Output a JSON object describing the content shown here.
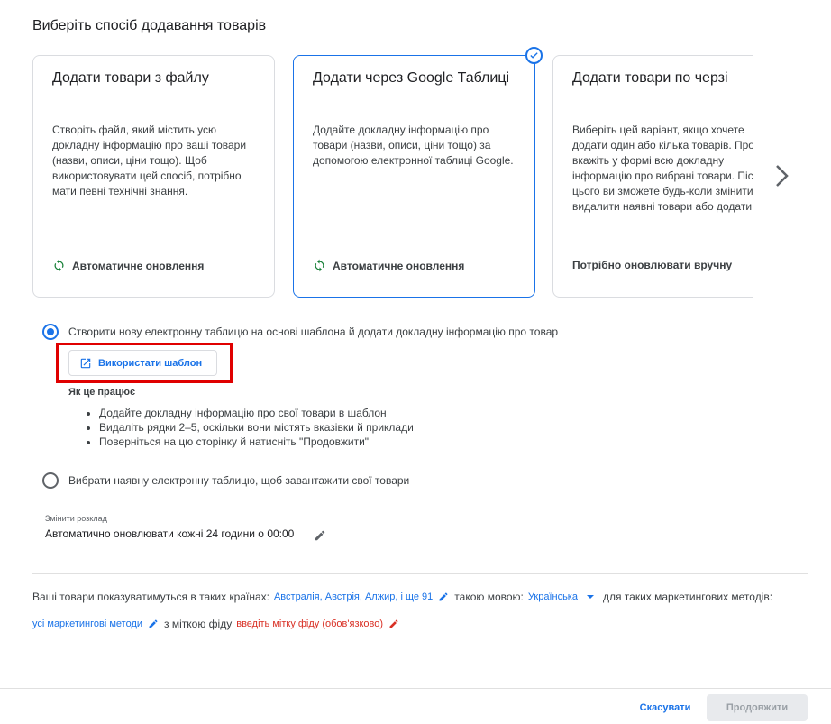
{
  "heading": "Виберіть спосіб додавання товарів",
  "cards": [
    {
      "title": "Додати товари з файлу",
      "description": "Створіть файл, який містить усю докладну інформацію про ваші товари (назви, описи, ціни тощо). Щоб використовувати цей спосіб, потрібно мати певні технічні знання.",
      "footer": "Автоматичне оновлення",
      "footer_icon": "sync-icon"
    },
    {
      "title": "Додати через Google Таблиці",
      "description": "Додайте докладну інформацію про товари (назви, описи, ціни тощо) за допомогою електронної таблиці Google.",
      "footer": "Автоматичне оновлення",
      "footer_icon": "sync-icon",
      "selected": true
    },
    {
      "title": "Додати товари по черзі",
      "description": "Виберіть цей варіант, якщо хочете додати один або кілька товарів. Просто вкажіть у формі всю докладну інформацію про вибрані товари. Після цього ви зможете будь-коли змінити чи видалити наявні товари або додати нові.",
      "footer": "Потрібно оновлювати вручну"
    }
  ],
  "option_new": {
    "label": "Створити нову електронну таблицю на основі шаблона й додати докладну інформацію про товар",
    "selected": true,
    "button_label": "Використати шаблон",
    "how_title": "Як це працює",
    "steps": [
      "Додайте докладну інформацію про свої товари в шаблон",
      "Видаліть рядки 2–5, оскільки вони містять вказівки й приклади",
      "Поверніться на цю сторінку й натисніть \"Продовжити\""
    ]
  },
  "option_existing": {
    "label": "Вибрати наявну електронну таблицю, щоб завантажити свої товари",
    "selected": false
  },
  "schedule": {
    "label": "Змінити розклад",
    "value": "Автоматично оновлювати кожні 24 години о 00:00"
  },
  "targeting": {
    "countries_prefix": "Ваші товари показуватимуться в таких країнах:",
    "countries_value": "Австралія, Австрія, Алжир, і ще 91",
    "language_prefix": "такою мовою:",
    "language_value": "Українська",
    "methods_prefix": "для таких маркетингових методів:",
    "methods_value": "усі маркетингові методи",
    "label_prefix": "з міткою фіду",
    "label_value": "введіть мітку фіду (обов'язково)"
  },
  "footer": {
    "cancel": "Скасувати",
    "continue": "Продовжити"
  },
  "colors": {
    "accent": "#1a73e8",
    "sync_green": "#188038",
    "error_red": "#d93025",
    "highlight_red": "#e00000"
  }
}
